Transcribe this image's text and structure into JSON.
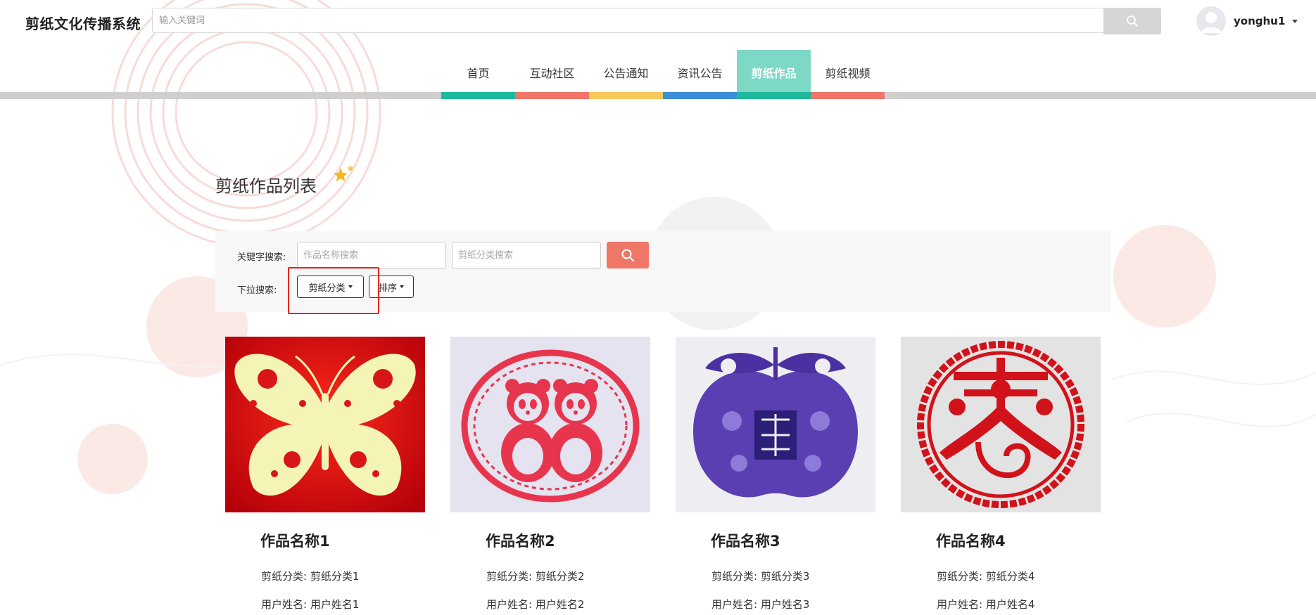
{
  "app": {
    "title": "剪纸文化传播系统"
  },
  "search": {
    "placeholder": "输入关键词"
  },
  "user": {
    "name": "yonghu1"
  },
  "nav": [
    {
      "label": "首页",
      "color": "#1fb89a"
    },
    {
      "label": "互动社区",
      "color": "#f0766a"
    },
    {
      "label": "公告通知",
      "color": "#f7c85c"
    },
    {
      "label": "资讯公告",
      "color": "#3a8fd8"
    },
    {
      "label": "剪纸作品",
      "color": "#1fb89a",
      "active": true,
      "active_bg": "#7dd8c6"
    },
    {
      "label": "剪纸视频",
      "color": "#f0766a"
    }
  ],
  "section": {
    "title": "剪纸作品列表"
  },
  "filter": {
    "keyword_label": "关键字搜索:",
    "name_placeholder": "作品名称搜索",
    "category_placeholder": "剪纸分类搜索",
    "dropdown_label": "下拉搜索:",
    "category_dropdown": "剪纸分类",
    "sort_dropdown": "排序"
  },
  "works": [
    {
      "name": "作品名称1",
      "category_label": "剪纸分类:",
      "category": "剪纸分类1",
      "user_label": "用户姓名:",
      "user": "用户姓名1",
      "image": "butterfly-papercut"
    },
    {
      "name": "作品名称2",
      "category_label": "剪纸分类:",
      "category": "剪纸分类2",
      "user_label": "用户姓名:",
      "user": "用户姓名2",
      "image": "panda-papercut"
    },
    {
      "name": "作品名称3",
      "category_label": "剪纸分类:",
      "category": "剪纸分类3",
      "user_label": "用户姓名:",
      "user": "用户姓名3",
      "image": "apple-fu-papercut"
    },
    {
      "name": "作品名称4",
      "category_label": "剪纸分类:",
      "category": "剪纸分类4",
      "user_label": "用户姓名:",
      "user": "用户姓名4",
      "image": "spring-papercut"
    }
  ],
  "colors": {
    "accent_red": "#ee7768",
    "highlight": "#e0261f",
    "nav_track": "#cfcfcf"
  }
}
